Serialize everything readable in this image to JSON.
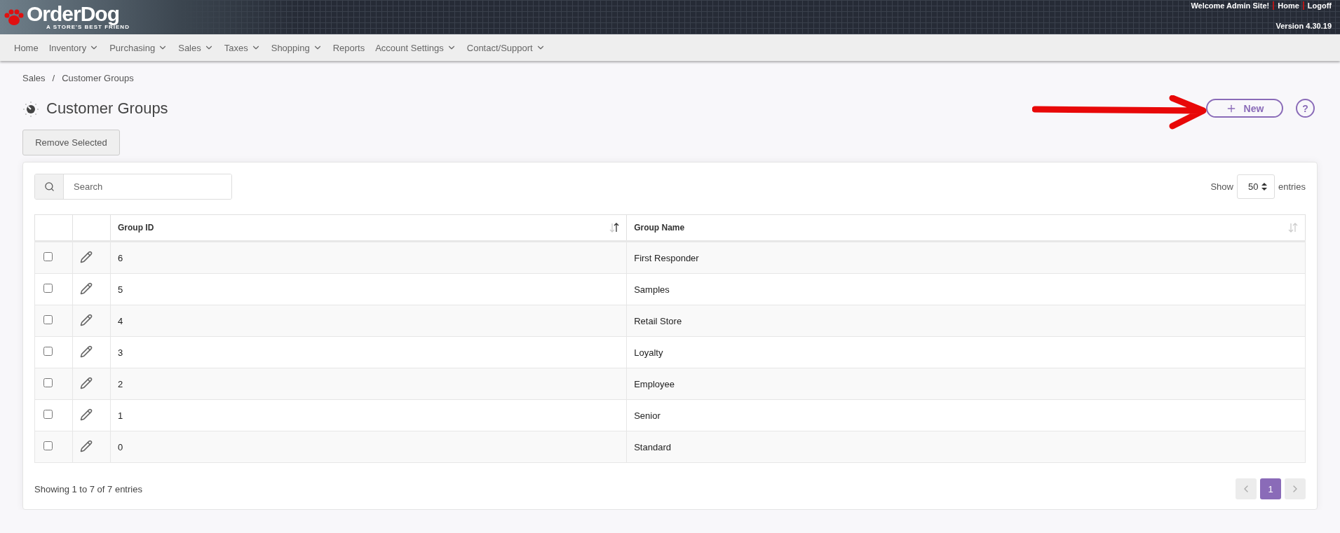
{
  "header": {
    "logo_text": "OrderDog",
    "logo_tagline": "A STORE'S BEST FRIEND",
    "welcome": "Welcome Admin Site!",
    "links": [
      "Home",
      "Logoff"
    ],
    "version": "Version 4.30.19"
  },
  "nav": [
    {
      "label": "Home",
      "dropdown": false
    },
    {
      "label": "Inventory",
      "dropdown": true
    },
    {
      "label": "Purchasing",
      "dropdown": true
    },
    {
      "label": "Sales",
      "dropdown": true
    },
    {
      "label": "Taxes",
      "dropdown": true
    },
    {
      "label": "Shopping",
      "dropdown": true
    },
    {
      "label": "Reports",
      "dropdown": false
    },
    {
      "label": "Account Settings",
      "dropdown": true
    },
    {
      "label": "Contact/Support",
      "dropdown": true
    }
  ],
  "breadcrumb": [
    "Sales",
    "Customer Groups"
  ],
  "breadcrumb_separator": "/",
  "page_title": "Customer Groups",
  "new_button": "New",
  "help_button": "?",
  "remove_button": "Remove Selected",
  "search": {
    "placeholder": "Search"
  },
  "page_size": {
    "prefix": "Show",
    "value": "50",
    "suffix": "entries"
  },
  "table": {
    "columns": [
      {
        "label": "Group ID",
        "sorted": true
      },
      {
        "label": "Group Name",
        "sorted": false
      }
    ],
    "rows": [
      {
        "id": "6",
        "name": "First Responder",
        "checked": false
      },
      {
        "id": "5",
        "name": "Samples",
        "checked": false
      },
      {
        "id": "4",
        "name": "Retail Store",
        "checked": false
      },
      {
        "id": "3",
        "name": "Loyalty",
        "checked": false
      },
      {
        "id": "2",
        "name": "Employee",
        "checked": false
      },
      {
        "id": "1",
        "name": "Senior",
        "checked": false
      },
      {
        "id": "0",
        "name": "Standard",
        "checked": false
      }
    ]
  },
  "footer": {
    "info": "Showing 1 to 7 of 7 entries",
    "pages": [
      {
        "label": "1",
        "selected": true
      }
    ]
  }
}
